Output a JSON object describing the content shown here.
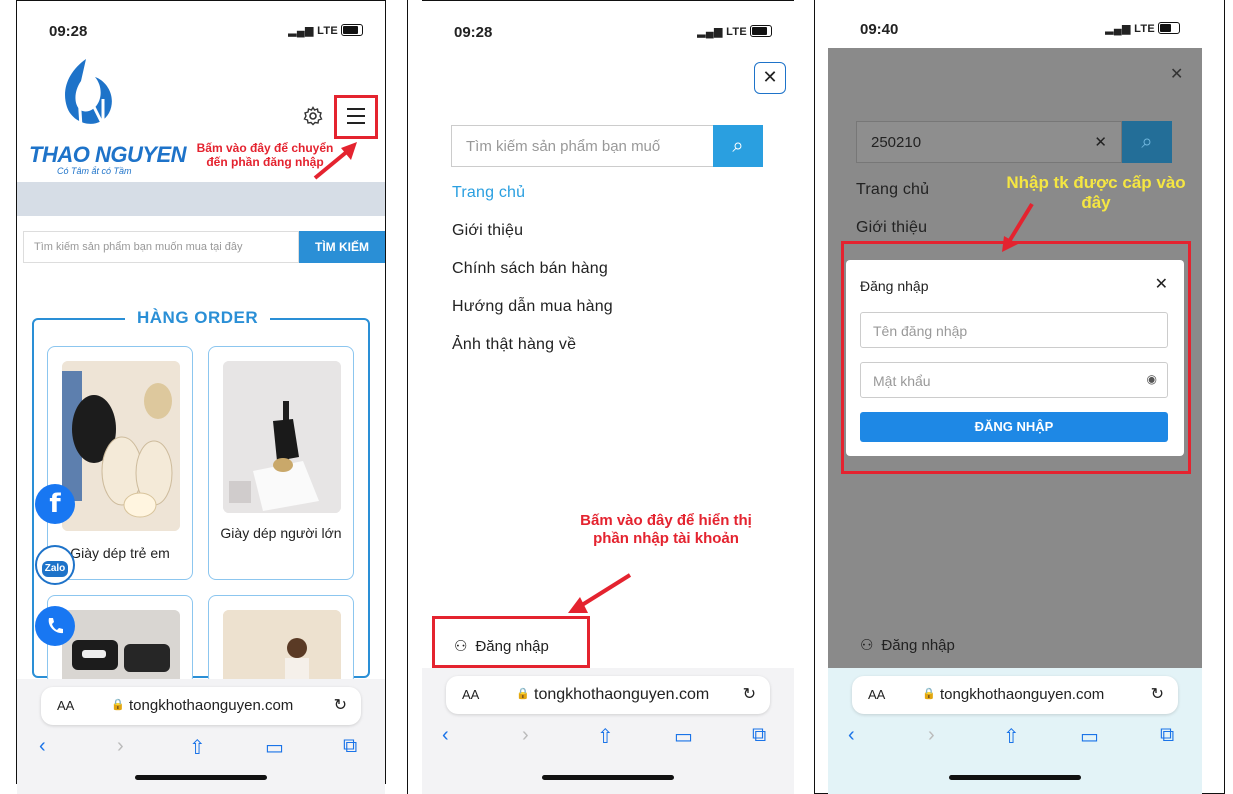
{
  "status": {
    "panel1_time": "09:28",
    "panel2_time": "09:28",
    "panel3_time": "09:40",
    "network": "LTE"
  },
  "browser": {
    "aa_label": "AA",
    "url": "tongkhothaonguyen.com"
  },
  "panel1": {
    "logo_name": "THAO NGUYEN",
    "logo_tagline": "Có Tâm ắt có Tầm",
    "annotation": "Bấm vào đây để chuyển đến phần đăng nhập",
    "search_placeholder": "Tìm kiếm sản phẩm bạn muốn mua tại đây",
    "search_button": "TÌM KIẾM",
    "section_title": "HÀNG ORDER",
    "products": [
      {
        "name": "Giày dép trẻ em"
      },
      {
        "name": "Giày dép người lớn"
      }
    ],
    "zalo_label": "Zalo"
  },
  "panel2": {
    "search_placeholder": "Tìm kiếm sản phẩm bạn muố",
    "menu": [
      "Trang chủ",
      "Giới thiệu",
      "Chính sách bán hàng",
      "Hướng dẫn mua hàng",
      "Ảnh thật hàng về"
    ],
    "annotation": "Bấm vào đây để hiển thị phần nhập tài khoản",
    "login_link": "Đăng nhập"
  },
  "panel3": {
    "search_value": "250210",
    "menu": [
      "Trang chủ",
      "Giới thiệu"
    ],
    "annotation": "Nhập tk được cấp vào đây",
    "modal_title": "Đăng nhập",
    "username_placeholder": "Tên đăng nhập",
    "password_placeholder": "Mật khẩu",
    "login_button": "ĐĂNG NHẬP",
    "login_link": "Đăng nhập"
  },
  "colors": {
    "brand_blue": "#2a8fd6",
    "annotation_red": "#e4232f",
    "annotation_yellow": "#f5e642"
  }
}
